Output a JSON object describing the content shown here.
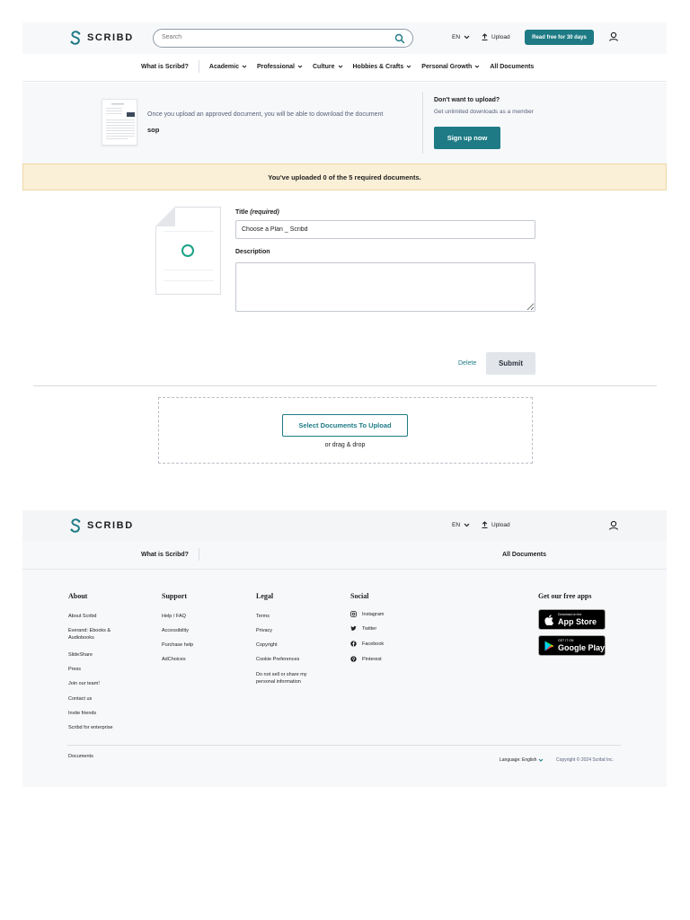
{
  "header": {
    "logo_text": "SCRIBD",
    "search_placeholder": "Search",
    "language": "EN",
    "upload_label": "Upload",
    "read_free_label": "Read free for 30 days"
  },
  "nav": {
    "what_is": "What is Scribd?",
    "items": [
      "Academic",
      "Professional",
      "Culture",
      "Hobbies & Crafts",
      "Personal Growth"
    ],
    "all_documents": "All Documents"
  },
  "upload_info": {
    "message": "Once you upload an approved document, you will be able to download the document",
    "doc_name": "sop",
    "promo_title": "Don't want to upload?",
    "promo_subtitle": "Get unlimited downloads as a member",
    "signup_label": "Sign up now"
  },
  "notice": "You've uploaded 0 of the 5 required documents.",
  "form": {
    "title_label": "Title",
    "title_required": "(required)",
    "title_value": "Choose a Plan _ Scribd",
    "description_label": "Description",
    "description_value": "",
    "delete_label": "Delete",
    "submit_label": "Submit"
  },
  "dropzone": {
    "select_label": "Select Documents To Upload",
    "drag_text": "or drag & drop"
  },
  "footer": {
    "logo_text": "SCRIBD",
    "language": "EN",
    "upload_label": "Upload",
    "what_is": "What is Scribd?",
    "all_documents": "All Documents",
    "about": {
      "heading": "About",
      "links": [
        "About Scribd",
        "Everand: Ebooks & Audiobooks",
        "SlideShare",
        "Press",
        "Join our team!",
        "Contact us",
        "Invite friends",
        "Scribd for enterprise"
      ]
    },
    "support": {
      "heading": "Support",
      "links": [
        "Help / FAQ",
        "Accessibility",
        "Purchase help",
        "AdChoices"
      ]
    },
    "legal": {
      "heading": "Legal",
      "links": [
        "Terms",
        "Privacy",
        "Copyright",
        "Cookie Preferences",
        "Do not sell or share my personal information"
      ]
    },
    "social": {
      "heading": "Social",
      "links": [
        "Instagram",
        "Twitter",
        "Facebook",
        "Pinterest"
      ]
    },
    "apps": {
      "heading": "Get our free apps",
      "app_store_small": "Download on the",
      "app_store_big": "App Store",
      "google_small": "GET IT ON",
      "google_big": "Google Play"
    },
    "documents_label": "Documents",
    "language_label": "Language: English",
    "copyright": "Copyright © 2024 Scribd Inc."
  },
  "colors": {
    "brand_teal": "#1e7b85",
    "notice_bg": "#faefd7",
    "spinner": "#1aa386"
  }
}
